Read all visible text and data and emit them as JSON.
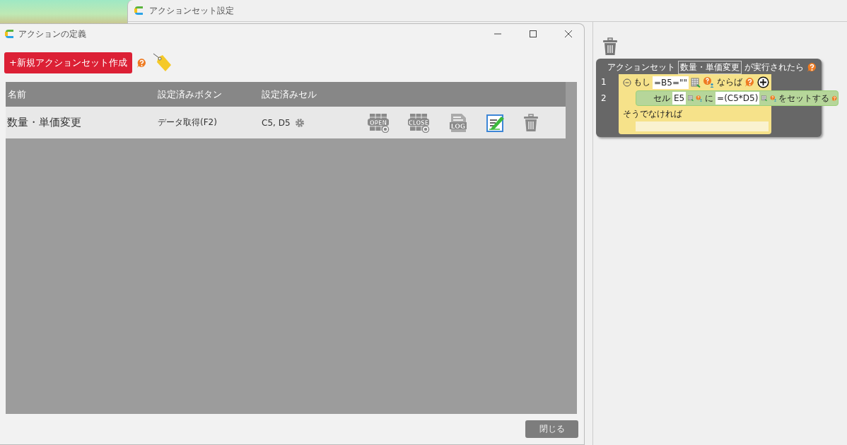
{
  "background_window": {
    "title": "アクションセット設定"
  },
  "action_set": {
    "header_prefix": "アクションセット",
    "name": "数量・単価変更",
    "header_suffix": "が実行されたら",
    "if_block": {
      "line": "1",
      "keyword": "もし",
      "condition": "=B5=\"\"",
      "then": "ならば",
      "else": "そうでなければ"
    },
    "set_block": {
      "line": "2",
      "label": "セル",
      "cell": "E5",
      "middle": "に",
      "value": "=(C5*D5)",
      "suffix": "をセットする"
    }
  },
  "dialog": {
    "title": "アクションの定義",
    "new_button": "+新規アクションセット作成",
    "table": {
      "columns": [
        "名前",
        "設定済みボタン",
        "設定済みセル"
      ],
      "rows": [
        {
          "name": "数量・単価変更",
          "button": "データ取得(F2)",
          "cells": "C5, D5",
          "actions": [
            {
              "kind": "open",
              "label": "OPEN"
            },
            {
              "kind": "close",
              "label": "CLOSE"
            },
            {
              "kind": "log",
              "label": "LOG"
            },
            {
              "kind": "edit"
            },
            {
              "kind": "delete"
            }
          ]
        }
      ]
    },
    "close_button": "閉じる"
  }
}
